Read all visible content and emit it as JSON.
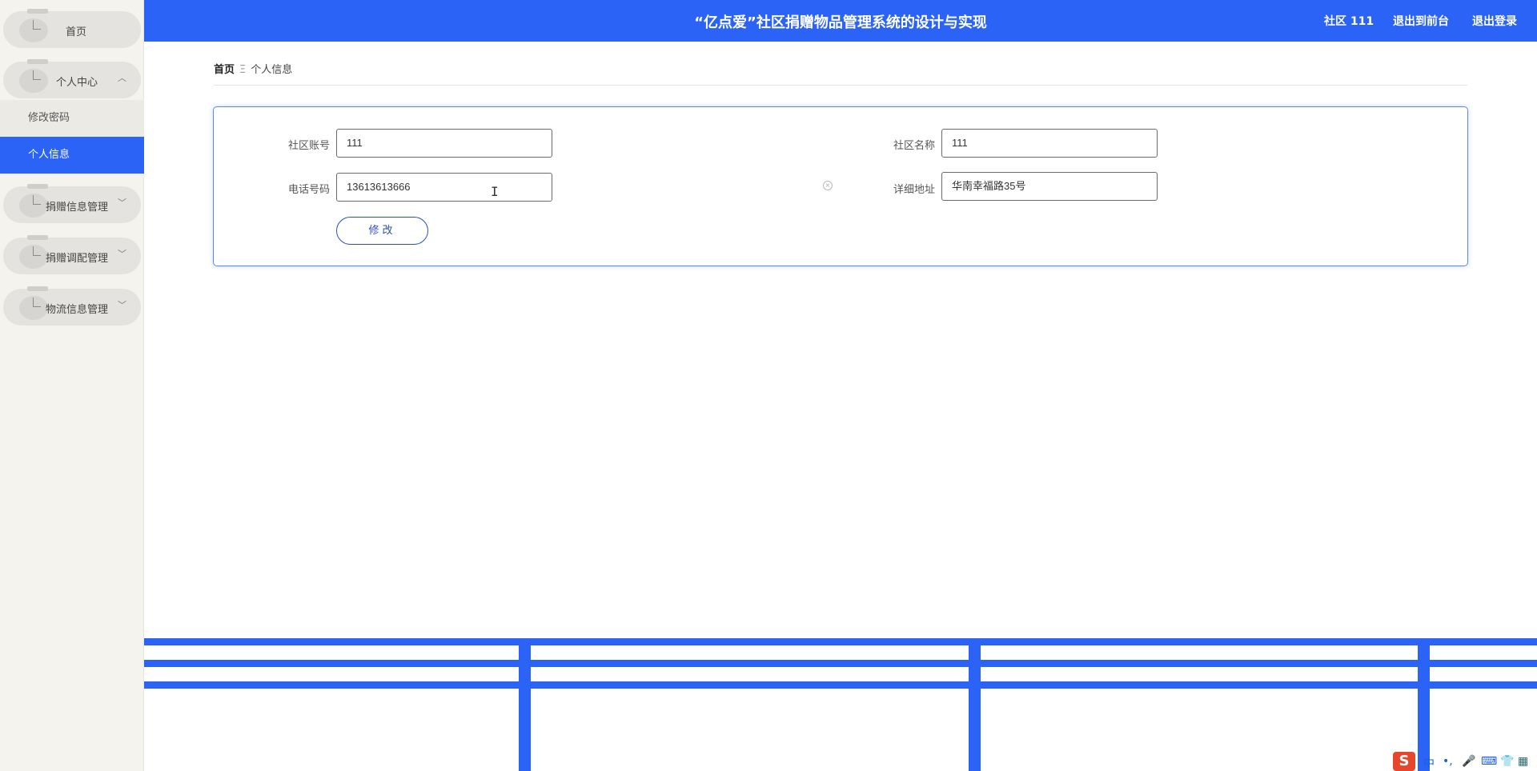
{
  "header": {
    "title": "“亿点爱”社区捐赠物品管理系统的设计与实现",
    "user": "社区 111",
    "to_front": "退出到前台",
    "logout": "退出登录"
  },
  "sidebar": {
    "items": [
      {
        "label": "首页"
      },
      {
        "label": "个人中心",
        "sub": [
          {
            "label": "修改密码"
          },
          {
            "label": "个人信息"
          }
        ]
      },
      {
        "label": "捐赠信息管理"
      },
      {
        "label": "捐赠调配管理"
      },
      {
        "label": "物流信息管理"
      }
    ]
  },
  "breadcrumb": {
    "home": "首页",
    "separator": "Ξ",
    "current": "个人信息"
  },
  "form": {
    "account_label": "社区账号",
    "account_value": "111",
    "name_label": "社区名称",
    "name_value": "111",
    "phone_label": "电话号码",
    "phone_value": "13613613666",
    "address_label": "详细地址",
    "address_value": "华南幸福路35号",
    "submit_label": "修改"
  },
  "ime": {
    "s": "S",
    "lang": "中",
    "punct": "•,"
  },
  "colors": {
    "primary": "#2a63f5",
    "sidebar_bg": "#f4f3ee"
  }
}
